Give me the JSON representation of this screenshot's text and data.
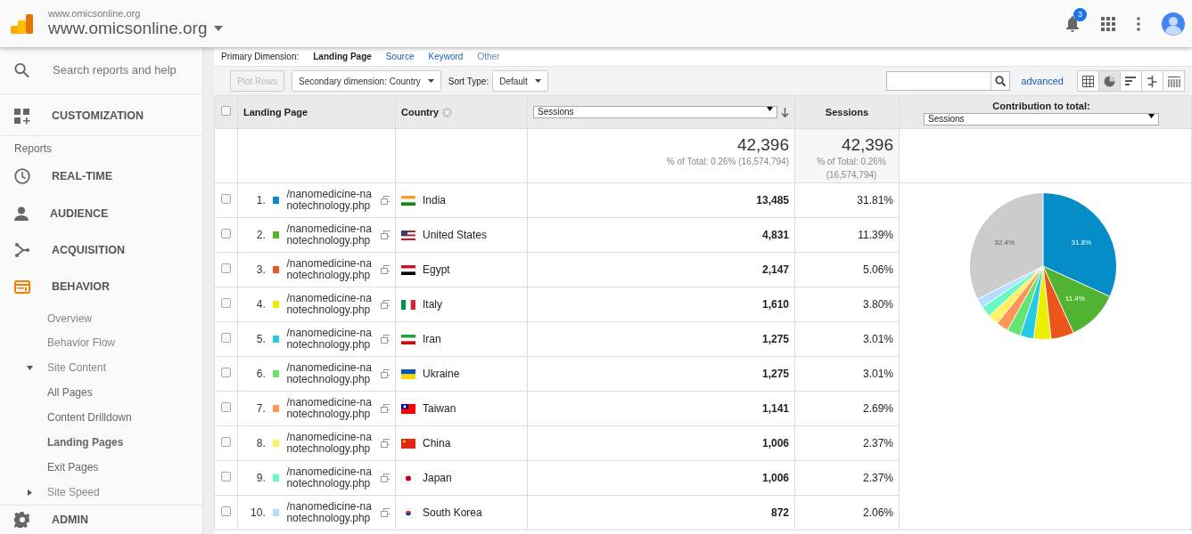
{
  "header": {
    "site_small": "www.omicsonline.org",
    "site_name": "www.omicsonline.org",
    "notification_count": "3"
  },
  "sidebar": {
    "search_placeholder": "Search reports and help",
    "customization": "CUSTOMIZATION",
    "reports_label": "Reports",
    "items": [
      {
        "label": "REAL-TIME",
        "kind": "clock",
        "selected": false
      },
      {
        "label": "AUDIENCE",
        "kind": "person",
        "selected": false
      },
      {
        "label": "ACQUISITION",
        "kind": "fork",
        "selected": false
      },
      {
        "label": "BEHAVIOR",
        "kind": "behavior",
        "selected": true,
        "children": [
          {
            "label": "Overview",
            "selected": false
          },
          {
            "label": "Behavior Flow",
            "selected": false
          },
          {
            "label": "Site Content",
            "selected": false,
            "expanded": true,
            "children": [
              {
                "label": "All Pages",
                "selected": false
              },
              {
                "label": "Content Drilldown",
                "selected": false
              },
              {
                "label": "Landing Pages",
                "selected": true
              },
              {
                "label": "Exit Pages",
                "selected": false
              }
            ]
          },
          {
            "label": "Site Speed",
            "selected": false,
            "expanded": false
          }
        ]
      }
    ],
    "admin": "ADMIN"
  },
  "primary_dimension": {
    "label": "Primary Dimension:",
    "options": [
      {
        "label": "Landing Page",
        "selected": true
      },
      {
        "label": "Source",
        "selected": false
      },
      {
        "label": "Keyword",
        "selected": false
      }
    ],
    "other": "Other"
  },
  "toolbar": {
    "plot_rows": {
      "label": "Plot Rows",
      "disabled": true
    },
    "secondary": "Secondary dimension: Country",
    "sort_label": "Sort Type:",
    "sort": "Default",
    "advanced": "advanced",
    "views": [
      {
        "kind": "table",
        "selected": false
      },
      {
        "kind": "pie",
        "selected": true
      },
      {
        "kind": "bars",
        "selected": false
      },
      {
        "kind": "compare",
        "selected": false
      },
      {
        "kind": "pivot",
        "selected": false
      }
    ]
  },
  "table": {
    "select_all_checked": false,
    "columns": {
      "landing_page": "Landing Page",
      "country": "Country",
      "metric_select": "Sessions",
      "metric": "Sessions",
      "contribution": "Contribution to total:",
      "contribution_select": "Sessions"
    },
    "totals": [
      {
        "value": "42,396",
        "note": "% of Total: 0.26% (16,574,794)"
      },
      {
        "value": "42,396",
        "note": "% of Total: 0.26% (16,574,794)"
      }
    ],
    "rows": [
      {
        "index": "1.",
        "page": "/nanomedicine-nanotechnology.php",
        "color": "#058dc7",
        "country": "India",
        "sessions": "13,485",
        "share": "31.81%",
        "checked": false
      },
      {
        "index": "2.",
        "page": "/nanomedicine-nanotechnology.php",
        "color": "#50b432",
        "country": "United States",
        "sessions": "4,831",
        "share": "11.39%",
        "checked": false
      },
      {
        "index": "3.",
        "page": "/nanomedicine-nanotechnology.php",
        "color": "#ed561b",
        "country": "Egypt",
        "sessions": "2,147",
        "share": "5.06%",
        "checked": false
      },
      {
        "index": "4.",
        "page": "/nanomedicine-nanotechnology.php",
        "color": "#edef00",
        "country": "Italy",
        "sessions": "1,610",
        "share": "3.80%",
        "checked": false
      },
      {
        "index": "5.",
        "page": "/nanomedicine-nanotechnology.php",
        "color": "#24cbe5",
        "country": "Iran",
        "sessions": "1,275",
        "share": "3.01%",
        "checked": false
      },
      {
        "index": "6.",
        "page": "/nanomedicine-nanotechnology.php",
        "color": "#64e572",
        "country": "Ukraine",
        "sessions": "1,275",
        "share": "3.01%",
        "checked": false
      },
      {
        "index": "7.",
        "page": "/nanomedicine-nanotechnology.php",
        "color": "#ff9655",
        "country": "Taiwan",
        "sessions": "1,141",
        "share": "2.69%",
        "checked": false
      },
      {
        "index": "8.",
        "page": "/nanomedicine-nanotechnology.php",
        "color": "#fff263",
        "country": "China",
        "sessions": "1,006",
        "share": "2.37%",
        "checked": false
      },
      {
        "index": "9.",
        "page": "/nanomedicine-nanotechnology.php",
        "color": "#6af9c4",
        "country": "Japan",
        "sessions": "1,006",
        "share": "2.37%",
        "checked": false
      },
      {
        "index": "10.",
        "page": "/nanomedicine-nanotechnology.php",
        "color": "#b2deff",
        "country": "South Korea",
        "sessions": "872",
        "share": "2.06%",
        "checked": false
      }
    ],
    "chart_data": {
      "type": "pie",
      "values": [
        31.81,
        11.39,
        5.06,
        3.8,
        3.01,
        3.01,
        2.69,
        2.37,
        2.37,
        2.06,
        32.43
      ],
      "colors": [
        "#058dc7",
        "#50b432",
        "#ed561b",
        "#edef00",
        "#24cbe5",
        "#64e572",
        "#ff9655",
        "#fff263",
        "#6af9c4",
        "#b2deff",
        "#cccccc"
      ],
      "value_labels": [
        "31.8%",
        "11.4%",
        null,
        null,
        null,
        null,
        null,
        null,
        null,
        null,
        "32.4%"
      ]
    }
  }
}
